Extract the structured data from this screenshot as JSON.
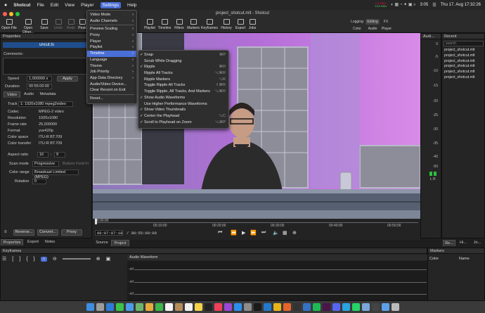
{
  "menubar": {
    "app_name": "Shotcut",
    "items": [
      "File",
      "Edit",
      "View",
      "Player",
      "Settings",
      "Help"
    ],
    "active": "Settings",
    "clock": "Thu 17. Aug  17:32:26",
    "time_small": "3:05",
    "net_up": "2,0 MB/s",
    "net_down": "19,9 kB/s"
  },
  "window": {
    "title": "project_shotcut.mlt - Shotcut"
  },
  "toolbar": {
    "left": [
      "Open File",
      "Open Other...",
      "Save",
      "Undo",
      "Redo",
      "Peak"
    ],
    "center": [
      "Playlist",
      "Timeline",
      "Filters",
      "Markers",
      "Keyframes",
      "History",
      "Export",
      "Jobs"
    ],
    "layouts": [
      "Logging",
      "Editing",
      "FX",
      "Color",
      "Audio",
      "Player"
    ],
    "active_layout": "Editing"
  },
  "properties": {
    "title": "Properties",
    "clip_name": "uncut.ts",
    "comments_label": "Comments:",
    "speed_label": "Speed",
    "speed_value": "1,000000 x",
    "apply_label": "Apply",
    "duration_label": "Duration",
    "duration_value": "00:55:00:00",
    "tabs": [
      "Video",
      "Audio",
      "Metadata"
    ],
    "track_label": "Track",
    "track_value": "1: 1920x1080 mpeg2video",
    "rows": [
      {
        "k": "Codec",
        "v": "MPEG-2 video"
      },
      {
        "k": "Resolution",
        "v": "1920x1080"
      },
      {
        "k": "Frame rate",
        "v": "25,000000"
      },
      {
        "k": "Format",
        "v": "yuv420p"
      },
      {
        "k": "Color space",
        "v": "ITU-R BT.709"
      },
      {
        "k": "Color transfer",
        "v": "ITU-R BT.709"
      }
    ],
    "aspect_label": "Aspect ratio",
    "aspect_w": "16",
    "aspect_h": "9",
    "scan_label": "Scan mode",
    "scan_value": "Progressive",
    "field_order": "Bottom Field Fi",
    "range_label": "Color range",
    "range_value": "Broadcast Limited (MPEG)",
    "rotation_label": "Rotation",
    "rotation_value": "0",
    "bottom_buttons": [
      "Reverse...",
      "Convert...",
      "Proxy"
    ],
    "lower_tabs": [
      "Properties",
      "Export",
      "Notes"
    ]
  },
  "settings_menu": {
    "items": [
      "Video Mode",
      "Audio Channels",
      "Preview Scaling",
      "Proxy",
      "Player",
      "Playlist",
      "Timeline",
      "Language",
      "Theme",
      "Job Priority",
      "App Data Directory",
      "Audio/Video Device...",
      "Clear Recent on Exit",
      "Reset..."
    ],
    "highlighted": "Timeline"
  },
  "timeline_submenu": {
    "items": [
      {
        "label": "Snap",
        "check": "✓",
        "sc": "⌘P"
      },
      {
        "label": "Scrub While Dragging",
        "check": "",
        "sc": ""
      },
      {
        "label": "Ripple",
        "check": "✓",
        "sc": "⌘R"
      },
      {
        "label": "Ripple All Tracks",
        "check": "",
        "sc": "⌥⌘R"
      },
      {
        "label": "Ripple Markers",
        "check": "",
        "sc": "⌥R"
      },
      {
        "label": "Toggle Ripple All Tracks",
        "check": "",
        "sc": "⇧⌘R"
      },
      {
        "label": "Toggle Ripple, All Tracks, And Markers",
        "check": "",
        "sc": "⌥⌘R"
      },
      {
        "label": "Show Audio Waveforms",
        "check": "✓",
        "sc": ""
      },
      {
        "label": "Use Higher Performance Waveforms",
        "check": "",
        "sc": ""
      },
      {
        "label": "Show Video Thumbnails",
        "check": "✓",
        "sc": ""
      },
      {
        "label": "Center the Playhead",
        "check": "✓",
        "sc": "⌥C"
      },
      {
        "label": "Scroll to Playhead on Zoom",
        "check": "✓",
        "sc": "⌥⌘P"
      }
    ]
  },
  "player": {
    "timecode": "00:07:07:18",
    "duration": "/ 00:55:00:00",
    "ruler": [
      "00:00:00",
      "00:10:00",
      "00:20:00",
      "00:30:00",
      "00:40:00",
      "00:50:00"
    ],
    "tabs": [
      "Source",
      "Project"
    ],
    "active_tab": "Project"
  },
  "audio": {
    "title": "Audi...",
    "scale": [
      "0",
      "-5",
      "-10",
      "-15",
      "-20",
      "-25",
      "-30",
      "-35",
      "-40",
      "-50"
    ],
    "channels": "L  R"
  },
  "recent": {
    "title": "Recent",
    "search_placeholder": "search",
    "items": [
      "project_shotcut.mlt",
      "project_shotcut.mlt",
      "project_shotcut.mlt",
      "project_shotcut.mlt",
      "project_shotcut.mlt",
      "project_shotcut.mlt"
    ],
    "bottom_tabs": [
      "Re...",
      "Hi...",
      "Jo..."
    ]
  },
  "keyframes": {
    "title": "Keyframes",
    "audio_waveform_label": "Audio Waveform",
    "db_labels": [
      "-inf",
      "-inf",
      "-inf"
    ]
  },
  "markers": {
    "title": "Markers",
    "col_color": "Color",
    "col_name": "Name"
  }
}
